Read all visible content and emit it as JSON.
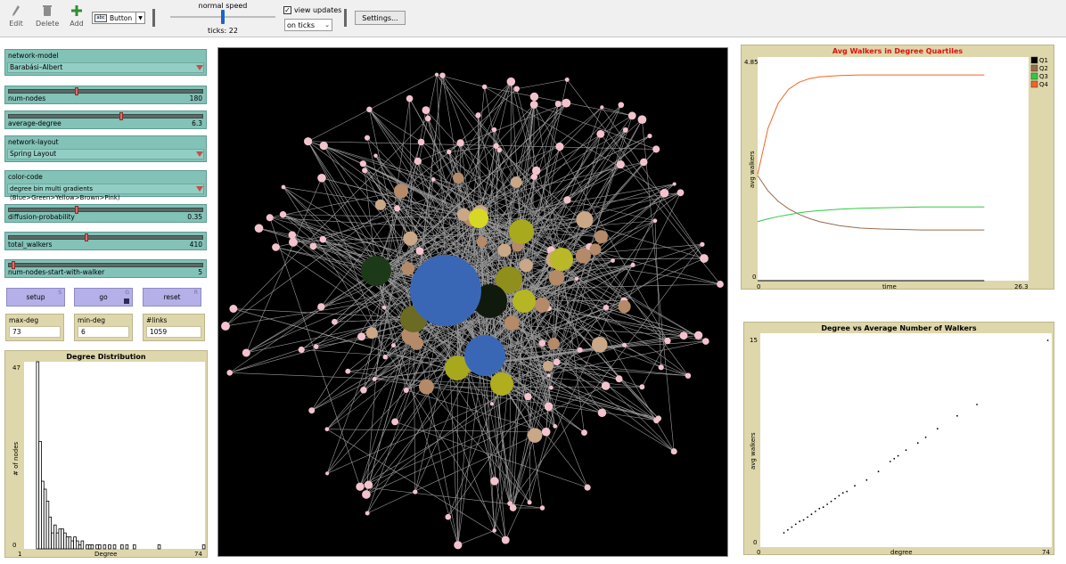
{
  "toolbar": {
    "edit": "Edit",
    "delete": "Delete",
    "add": "Add",
    "widget_type": "Button",
    "speed_label": "normal speed",
    "speed_fraction": 0.5,
    "ticks_label": "ticks: 22",
    "view_updates_label": "view updates",
    "view_updates_checked": true,
    "update_mode": "on ticks",
    "settings": "Settings..."
  },
  "choosers": {
    "network_model": {
      "label": "network-model",
      "value": "Barabási–Albert"
    },
    "network_layout": {
      "label": "network-layout",
      "value": "Spring Layout"
    },
    "color_code": {
      "label": "color-code",
      "value": "degree bin multi gradients (Blue>Green>Yellow>Brown>Pink)"
    }
  },
  "sliders": {
    "num_nodes": {
      "name": "num-nodes",
      "value": "180",
      "fraction": 0.35
    },
    "average_degree": {
      "name": "average-degree",
      "value": "6.3",
      "fraction": 0.58
    },
    "diffusion_probability": {
      "name": "diffusion-probability",
      "value": "0.35",
      "fraction": 0.35
    },
    "total_walkers": {
      "name": "total_walkers",
      "value": "410",
      "fraction": 0.4
    },
    "num_start": {
      "name": "num-nodes-start-with-walker",
      "value": "5",
      "fraction": 0.02
    }
  },
  "buttons": {
    "setup": {
      "label": "setup",
      "key": "S"
    },
    "go": {
      "label": "go",
      "key": "G"
    },
    "reset": {
      "label": "reset",
      "key": "R"
    }
  },
  "monitors": {
    "max_deg": {
      "label": "max-deg",
      "value": "73"
    },
    "min_deg": {
      "label": "min-deg",
      "value": "6"
    },
    "links": {
      "label": "#links",
      "value": "1059"
    }
  },
  "plots": {
    "degree_distribution": {
      "title": "Degree Distribution",
      "xlabel": "Degree",
      "ylabel": "# of nodes",
      "xmin": "1",
      "xmax": "74",
      "ymin": "0",
      "ymax": "47"
    },
    "avg_walkers": {
      "title": "Avg Walkers in Degree Quartiles",
      "xlabel": "time",
      "ylabel": "avg walkers",
      "xmin": "0",
      "xmax": "26.3",
      "ymin": "0",
      "ymax": "4.85",
      "title_color": "#e01010"
    },
    "degree_vs_walkers": {
      "title": "Degree vs Average Number of Walkers",
      "xlabel": "degree",
      "ylabel": "avg walkers",
      "xmin": "0",
      "xmax": "74",
      "ymin": "0",
      "ymax": "15"
    }
  },
  "chart_data": [
    {
      "type": "bar",
      "title": "Degree Distribution",
      "xlabel": "Degree",
      "ylabel": "# of nodes",
      "xlim": [
        1,
        74
      ],
      "ylim": [
        0,
        47
      ],
      "x": [
        6,
        7,
        8,
        9,
        10,
        11,
        12,
        13,
        14,
        15,
        16,
        17,
        18,
        19,
        20,
        21,
        22,
        23,
        24,
        26,
        27,
        28,
        30,
        31,
        33,
        35,
        37,
        40,
        42,
        45,
        55,
        73
      ],
      "values": [
        47,
        27,
        17,
        15,
        12,
        8,
        4,
        6,
        4,
        5,
        5,
        4,
        3,
        3,
        2,
        3,
        2,
        1,
        2,
        1,
        1,
        1,
        1,
        1,
        1,
        1,
        1,
        1,
        1,
        1,
        1,
        1
      ]
    },
    {
      "type": "line",
      "title": "Avg Walkers in Degree Quartiles",
      "xlabel": "time",
      "ylabel": "avg walkers",
      "xlim": [
        0,
        26.3
      ],
      "ylim": [
        0,
        4.85
      ],
      "x": [
        0,
        1,
        2,
        3,
        4,
        5,
        6,
        8,
        10,
        12,
        14,
        16,
        18,
        20,
        22
      ],
      "series": [
        {
          "name": "Q1",
          "color": "#000000",
          "values": [
            0,
            0,
            0,
            0,
            0,
            0,
            0,
            0,
            0,
            0,
            0,
            0,
            0,
            0,
            0
          ]
        },
        {
          "name": "Q2",
          "color": "#9b6b4a",
          "values": [
            2.28,
            1.95,
            1.72,
            1.56,
            1.44,
            1.35,
            1.28,
            1.19,
            1.14,
            1.12,
            1.11,
            1.1,
            1.1,
            1.1,
            1.1
          ]
        },
        {
          "name": "Q3",
          "color": "#2ecc40",
          "values": [
            1.28,
            1.34,
            1.39,
            1.43,
            1.47,
            1.5,
            1.52,
            1.55,
            1.57,
            1.58,
            1.59,
            1.6,
            1.6,
            1.6,
            1.6
          ]
        },
        {
          "name": "Q4",
          "color": "#f26522",
          "values": [
            2.3,
            3.3,
            3.85,
            4.15,
            4.3,
            4.38,
            4.42,
            4.45,
            4.46,
            4.46,
            4.46,
            4.46,
            4.46,
            4.46,
            4.46
          ]
        }
      ]
    },
    {
      "type": "scatter",
      "title": "Degree vs Average Number of Walkers",
      "xlabel": "degree",
      "ylabel": "avg walkers",
      "xlim": [
        0,
        74
      ],
      "ylim": [
        0,
        15
      ],
      "points": [
        [
          6,
          1.0
        ],
        [
          7,
          1.2
        ],
        [
          8,
          1.4
        ],
        [
          9,
          1.6
        ],
        [
          10,
          1.8
        ],
        [
          11,
          1.9
        ],
        [
          12,
          2.1
        ],
        [
          13,
          2.3
        ],
        [
          14,
          2.5
        ],
        [
          15,
          2.7
        ],
        [
          16,
          2.8
        ],
        [
          17,
          3.0
        ],
        [
          18,
          3.2
        ],
        [
          19,
          3.4
        ],
        [
          20,
          3.6
        ],
        [
          21,
          3.8
        ],
        [
          22,
          3.9
        ],
        [
          24,
          4.3
        ],
        [
          27,
          4.7
        ],
        [
          30,
          5.3
        ],
        [
          33,
          6.0
        ],
        [
          34,
          6.2
        ],
        [
          35,
          6.4
        ],
        [
          37,
          6.8
        ],
        [
          40,
          7.3
        ],
        [
          42,
          7.7
        ],
        [
          45,
          8.3
        ],
        [
          50,
          9.2
        ],
        [
          55,
          10.0
        ],
        [
          73,
          14.5
        ]
      ]
    }
  ]
}
